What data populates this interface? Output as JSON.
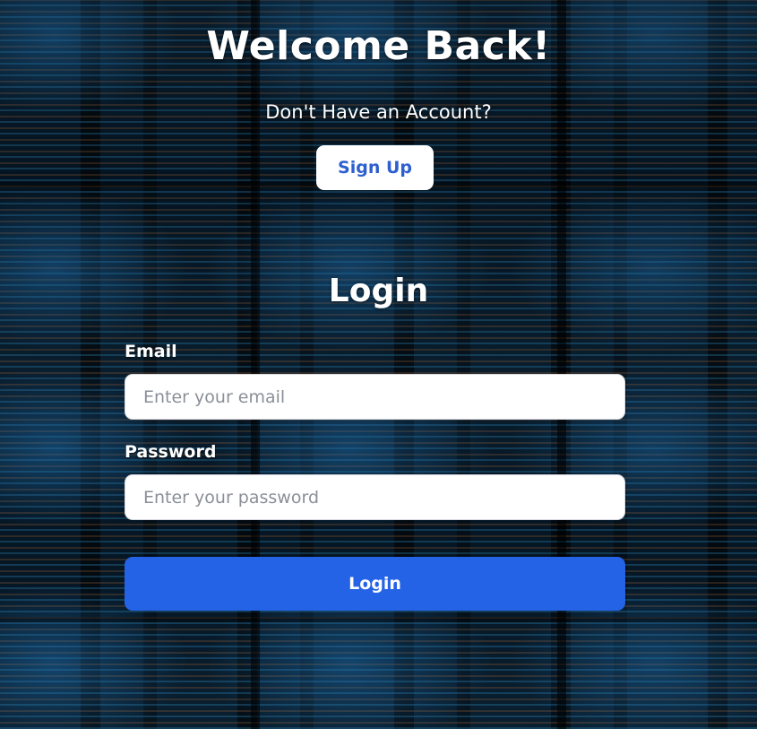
{
  "hero": {
    "heading": "Welcome Back!",
    "prompt": "Don't Have an Account?",
    "signup_label": "Sign Up"
  },
  "login_form": {
    "title": "Login",
    "email": {
      "label": "Email",
      "placeholder": "Enter your email",
      "value": ""
    },
    "password": {
      "label": "Password",
      "placeholder": "Enter your password",
      "value": ""
    },
    "submit_label": "Login"
  },
  "colors": {
    "primary_button": "#2563e6",
    "signup_text": "#2d5fd0",
    "input_background": "#ffffff",
    "text": "#ffffff"
  },
  "background": {
    "style": "blurred code editor image, tiled"
  }
}
